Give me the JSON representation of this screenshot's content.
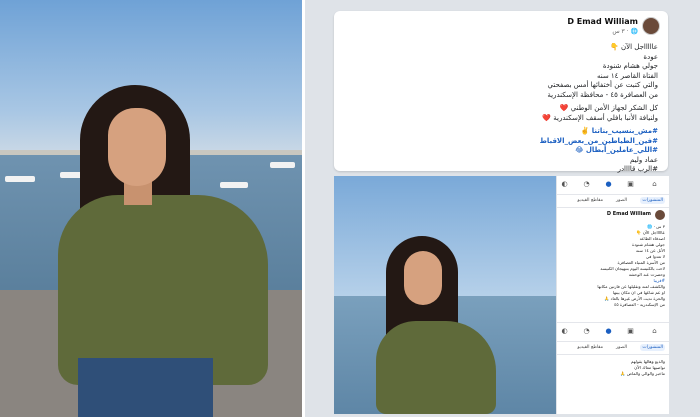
{
  "post": {
    "author": "D Emad William",
    "time": "٣ س",
    "lines": [
      {
        "text": "عاااااجل الآن",
        "emoji": "👇",
        "highlight": false
      },
      {
        "text": "عودة",
        "highlight": false
      },
      {
        "text": "جولي هشام شنودة",
        "highlight": false
      },
      {
        "text": "الفتاة القاصر ١٤ سنه",
        "highlight": false
      },
      {
        "text": "والتي كتبت عن أختفائها أمس بصفحتي",
        "highlight": false
      },
      {
        "text": "من العصافرة ٤٥ - محافظة الإسكندرية",
        "highlight": false
      },
      {
        "text": "كل الشكر لجهاز الأمن الوطني ❤️",
        "highlight": false
      },
      {
        "text": "ولنيافة الأنبا بافلي أسقف الإسكندرية ❤️",
        "highlight": false
      },
      {
        "text": "#مش_بنسيب_بناتنا ✌️",
        "highlight": true
      },
      {
        "text": "#فين_الطياطين_من_بعض_الاقباط",
        "highlight": true
      },
      {
        "text": "#اللي_عاملين_أبطال 😂",
        "highlight": true
      },
      {
        "text": "عماد وليم",
        "highlight": false
      },
      {
        "text": "#الرب قاااادر",
        "highlight": false
      }
    ]
  },
  "mini": {
    "author": "D Emad William",
    "tabs": [
      "المنشورات",
      "الصور",
      "مقاطع الفيديو"
    ],
    "lines": [
      "٣ س · 🌐",
      "عاااااجل الآن 👇",
      "اصدقاء الطاعة",
      "جولي هشام شنودة",
      "الأثل عن ١٤ سنه",
      "لا تعدوا في",
      "من الأسرة المنياء العصافرة",
      "لاحت بالكنيسة اليوم بتبهيجان الكنيسة",
      "وحصرت عند الوحشة",
      "#قريبا",
      "والكشف لعنه وتقليلها عن فارتين مكانها",
      "او عم شاغها في ان مكان بينها",
      "والحرة نديت الأرض غيرها بالعاد 🙏",
      "من الإسكندرية - العصافرة ٤٥"
    ],
    "bottom_lines": [
      "والذيع وهالها يقولهم",
      "تواصيها معاك الآن",
      "ماخبر والوالي والماض 🙏"
    ]
  },
  "icons": [
    "home-icon",
    "video-icon",
    "people-icon",
    "notifications-icon",
    "menu-icon"
  ]
}
